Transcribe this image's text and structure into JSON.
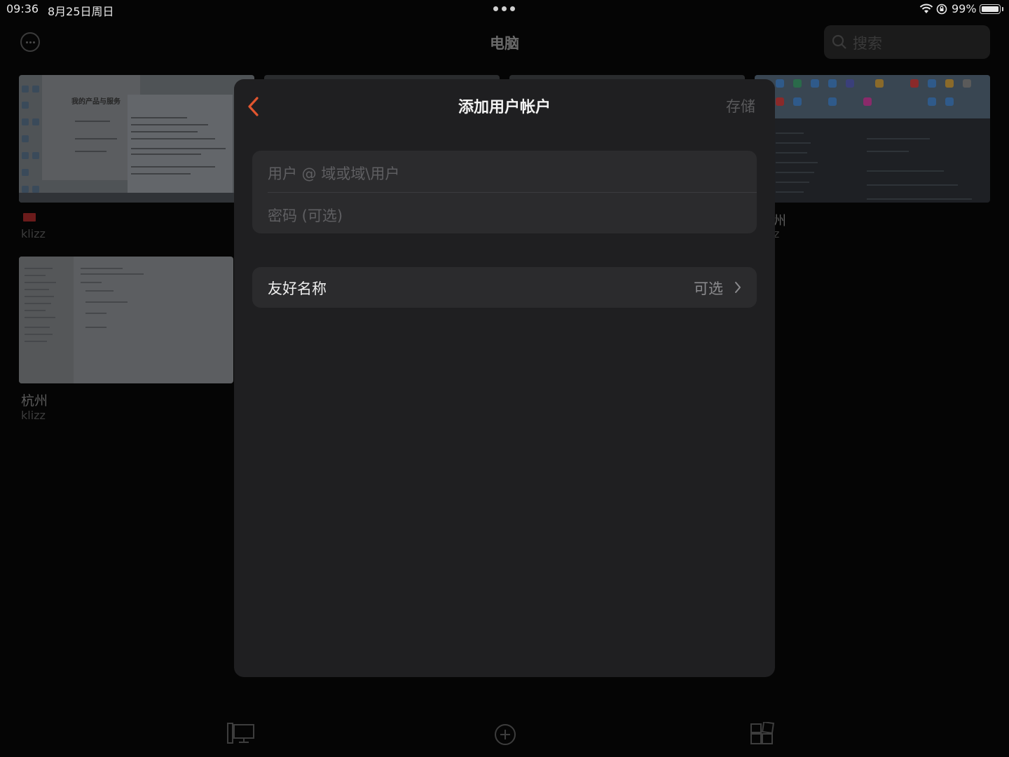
{
  "status_bar": {
    "time": "09:36",
    "date": "8月25日周日",
    "battery": "99%"
  },
  "background": {
    "title": "电脑",
    "search_placeholder": "搜索",
    "desktop_heading": "我的产品与服务",
    "cards": [
      {
        "name": "",
        "sub": "klizz"
      },
      {
        "name": "州",
        "sub": "z"
      },
      {
        "name": "杭州",
        "sub": "klizz"
      }
    ]
  },
  "modal": {
    "title": "添加用户帐户",
    "save_label": "存储",
    "user_placeholder": "用户 @ 域或域\\用户",
    "password_placeholder": "密码 (可选)",
    "friendly_label": "友好名称",
    "friendly_value": "可选"
  },
  "colors": {
    "accent": "#e0552f",
    "modal_background": "#1f1f21",
    "field_background": "#2b2b2d"
  },
  "icons": {
    "back": "chevron-left-icon",
    "search": "search-icon",
    "more": "more-icon",
    "tab_desktops": "desktop-icon",
    "tab_add": "add-icon",
    "tab_apps": "grid-icon"
  }
}
